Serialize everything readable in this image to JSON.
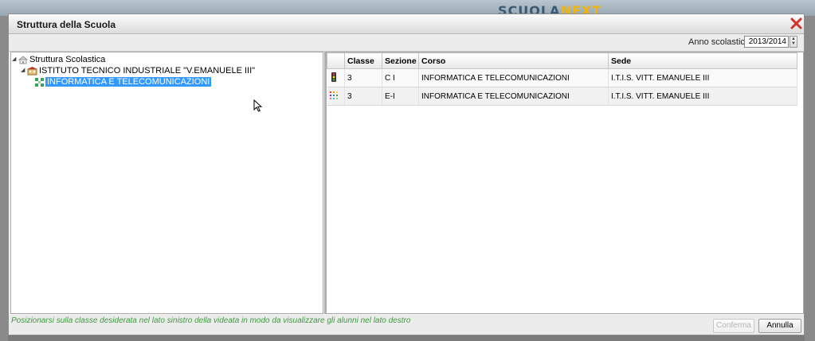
{
  "background": {
    "logo_main": "SCUOLA",
    "logo_accent": "NEXT"
  },
  "dialog": {
    "title": "Struttura della Scuola",
    "close_icon": "close-x-icon"
  },
  "toolbar": {
    "year_label": "Anno scolastico:",
    "year_value": "2013/2014"
  },
  "tree": {
    "root": {
      "label": "Struttura Scolastica",
      "icon": "school-building-icon"
    },
    "institute": {
      "label": "ISTITUTO TECNICO INDUSTRIALE \"V.EMANUELE III\"",
      "icon": "institute-icon"
    },
    "course": {
      "label": "INFORMATICA E TELECOMUNICAZIONI",
      "icon": "course-icon",
      "selected": true
    }
  },
  "grid": {
    "columns": [
      "",
      "Classe",
      "Sezione",
      "Corso",
      "Sede"
    ],
    "rows": [
      {
        "icon": "traffic-light-icon",
        "classe": "3",
        "sezione": "C I",
        "corso": "INFORMATICA E TELECOMUNICAZIONI",
        "sede": "I.T.I.S. VITT. EMANUELE III"
      },
      {
        "icon": "grid-dots-icon",
        "classe": "3",
        "sezione": "E-I",
        "corso": "INFORMATICA E TELECOMUNICAZIONI",
        "sede": "I.T.I.S. VITT. EMANUELE III"
      }
    ]
  },
  "footer": {
    "hint": "Posizionarsi sulla classe desiderata nel lato sinistro della videata in modo da visualizzare gli alunni nel lato destro",
    "confirm_label": "Conferma",
    "cancel_label": "Annulla"
  },
  "colors": {
    "selection": "#3399ff",
    "hint_text": "#3c9a3c",
    "close_icon": "#d0312d"
  }
}
